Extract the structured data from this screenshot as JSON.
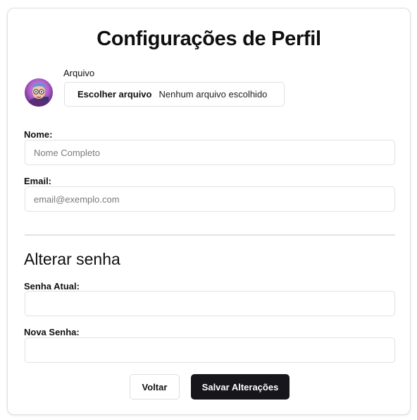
{
  "page": {
    "title": "Configurações de Perfil"
  },
  "avatar": {
    "icon": "avatar-illustration"
  },
  "file": {
    "label": "Arquivo",
    "button_label": "Escolher arquivo",
    "status": "Nenhum arquivo escolhido"
  },
  "profile": {
    "name_label": "Nome:",
    "name_placeholder": "Nome Completo",
    "name_value": "",
    "email_label": "Email:",
    "email_placeholder": "email@exemplo.com",
    "email_value": ""
  },
  "password": {
    "section_title": "Alterar senha",
    "current_label": "Senha Atual:",
    "current_value": "",
    "new_label": "Nova Senha:",
    "new_value": ""
  },
  "actions": {
    "back_label": "Voltar",
    "save_label": "Salvar Alterações"
  },
  "colors": {
    "primary_button": "#17171b",
    "border": "#e1e1e1"
  }
}
